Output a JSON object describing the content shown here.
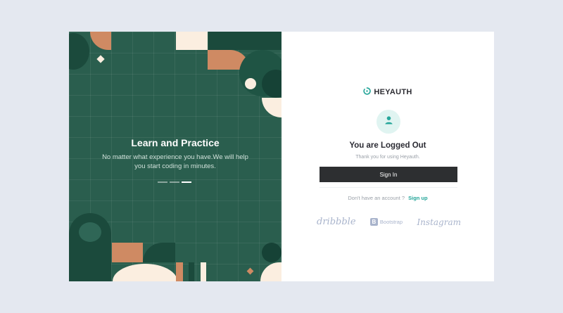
{
  "slide": {
    "title": "Learn and Practice",
    "text": "No matter what experience you have.We will help you start coding in minutes."
  },
  "brand": {
    "name": "HEYAUTH"
  },
  "auth": {
    "title": "You are Logged Out",
    "subtitle": "Thank you for using Heyauth.",
    "signin_label": "Sign In",
    "signup_prompt": "Don't have an account ?",
    "signup_link": "Sign up"
  },
  "logos": {
    "dribbble": "dribbble",
    "bootstrap": "Bootstrap",
    "bootstrap_mark": "B",
    "instagram": "Instagram"
  },
  "colors": {
    "panel_green": "#2a5e4e",
    "dark_green": "#1b4a3c",
    "terracotta": "#cf8a63",
    "cream": "#fbeee0",
    "accent_teal": "#26a69a",
    "button_dark": "#2d2f31"
  }
}
